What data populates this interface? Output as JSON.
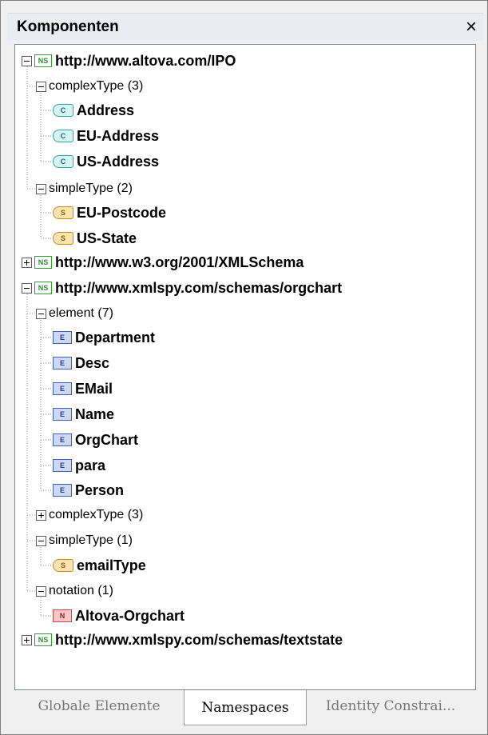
{
  "panel": {
    "title": "Komponenten",
    "close_glyph": "×"
  },
  "tree": {
    "ns1": {
      "label": "http://www.altova.com/IPO",
      "badge": "NS"
    },
    "ns1_ct": {
      "label": "complexType (3)"
    },
    "ns1_ct_items": [
      "Address",
      "EU-Address",
      "US-Address"
    ],
    "ns1_st": {
      "label": "simpleType (2)"
    },
    "ns1_st_items": [
      "EU-Postcode",
      "US-State"
    ],
    "ns2": {
      "label": "http://www.w3.org/2001/XMLSchema",
      "badge": "NS"
    },
    "ns3": {
      "label": "http://www.xmlspy.com/schemas/orgchart",
      "badge": "NS"
    },
    "ns3_el": {
      "label": "element (7)"
    },
    "ns3_el_items": [
      "Department",
      "Desc",
      "EMail",
      "Name",
      "OrgChart",
      "para",
      "Person"
    ],
    "ns3_ct": {
      "label": "complexType (3)"
    },
    "ns3_st": {
      "label": "simpleType (1)"
    },
    "ns3_st_items": [
      "emailType"
    ],
    "ns3_no": {
      "label": "notation (1)"
    },
    "ns3_no_items": [
      "Altova-Orgchart"
    ],
    "ns4": {
      "label": "http://www.xmlspy.com/schemas/textstate",
      "badge": "NS"
    }
  },
  "badges": {
    "complex": "C",
    "simple": "S",
    "element": "E",
    "notation": "N"
  },
  "tabs": [
    {
      "label": "Globale Elemente",
      "active": false
    },
    {
      "label": "Namespaces",
      "active": true
    },
    {
      "label": "Identity Constrai...",
      "active": false
    }
  ]
}
